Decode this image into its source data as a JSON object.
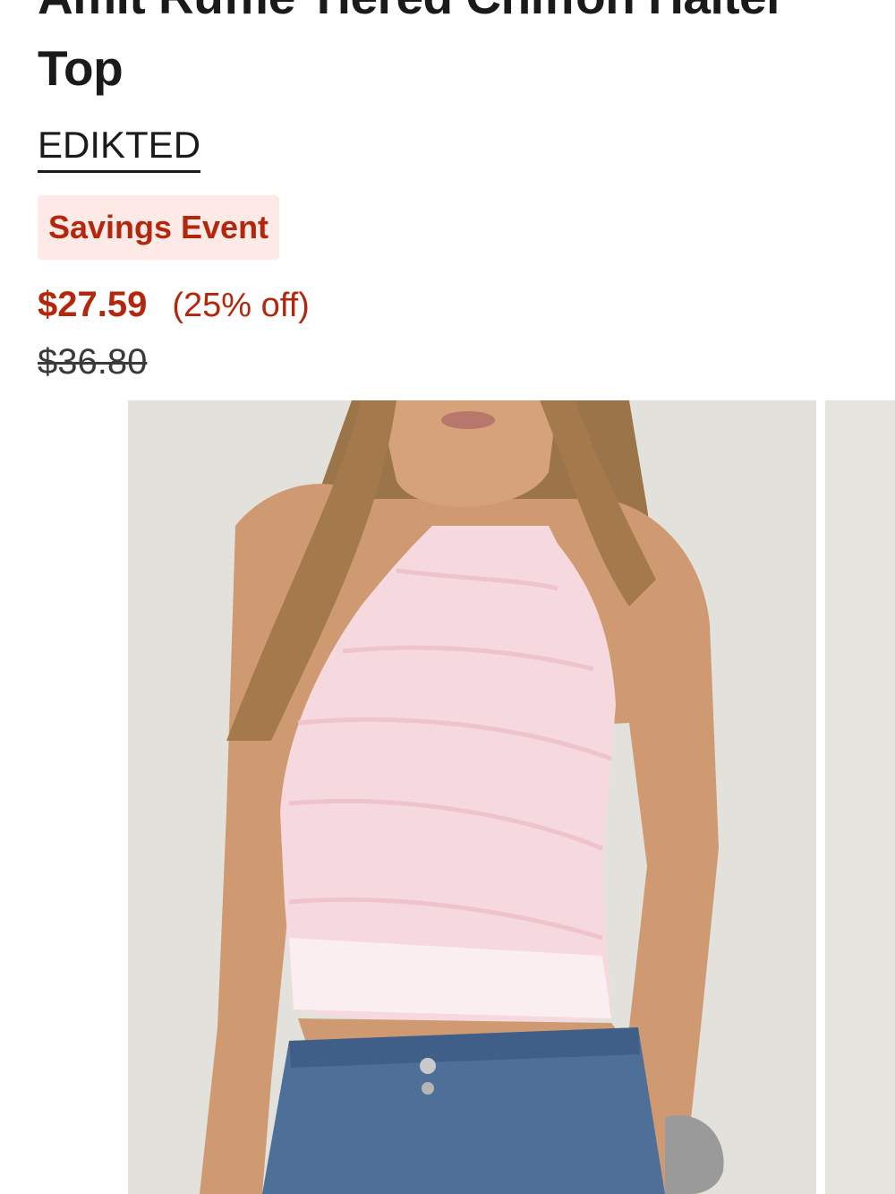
{
  "product": {
    "title": "Amit Ruffle Tiered Chiffon Halter Top",
    "brand": "EDIKTED",
    "badge": "Savings Event",
    "sale_price": "$27.59",
    "discount": "(25% off)",
    "original_price": "$36.80"
  },
  "gallery": {
    "current_image": "product-photo-model-pink-halter-top",
    "next_image_peek": true
  },
  "colors": {
    "accent": "#b3270d",
    "badge_bg": "#fde9e6",
    "text": "#1a1a1a"
  }
}
